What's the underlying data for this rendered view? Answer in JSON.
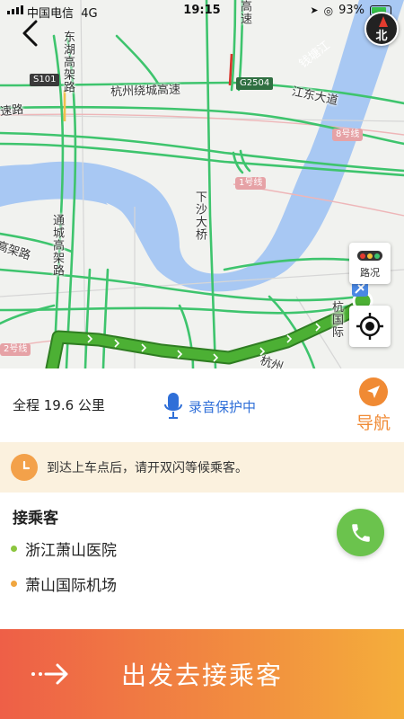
{
  "status_bar": {
    "carrier": "中国电信",
    "network": "4G",
    "time": "19:15",
    "battery": "93%"
  },
  "map": {
    "compass_label": "北",
    "labels": {
      "dong_hu": "东湖高架路",
      "tong_cheng": "通城高架路",
      "xia_sha_bridge": "下沙大桥",
      "gao_su": "高速",
      "hangzhou_ring": "杭州绕城高速",
      "jiang_dong": "江东大道",
      "su_lu": "速路",
      "gao_jia_lu": "高架路",
      "qiantang": "钱塘江",
      "hang_zhou": "杭州",
      "airport": "杭\n国际"
    },
    "shields": {
      "s101": "S101",
      "g2504": "G2504",
      "line8": "8号线",
      "line1": "1号线",
      "line2": "2号线"
    },
    "traffic_label": "路况",
    "colors": {
      "road": "#3ec46d",
      "water": "#a8c8f3",
      "route": "#4cb034",
      "route_border": "#2f7d22"
    }
  },
  "trip": {
    "distance": "全程 19.6 公里",
    "recording": "录音保护中",
    "navigate": "导航"
  },
  "notice": {
    "text": "到达上车点后，请开双闪等候乘客。"
  },
  "pickup": {
    "heading": "接乘客",
    "origin": "浙江萧山医院",
    "destination": "萧山国际机场",
    "origin_color": "#8cc63f",
    "destination_color": "#f0a640"
  },
  "action": {
    "depart": "出发去接乘客"
  }
}
